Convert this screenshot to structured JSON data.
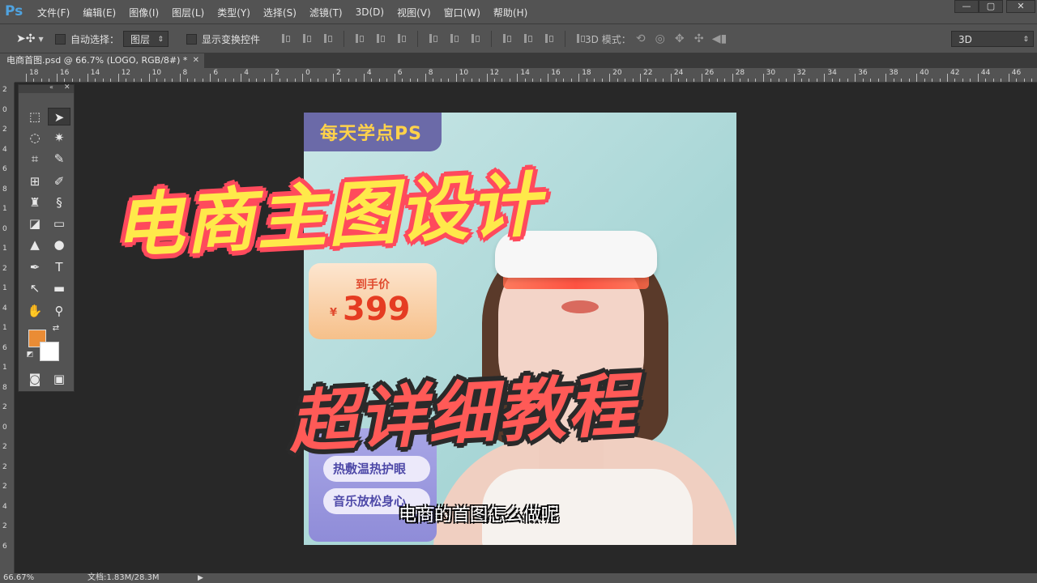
{
  "app": {
    "logo": "Ps"
  },
  "menu": [
    "文件(F)",
    "编辑(E)",
    "图像(I)",
    "图层(L)",
    "类型(Y)",
    "选择(S)",
    "滤镜(T)",
    "3D(D)",
    "视图(V)",
    "窗口(W)",
    "帮助(H)"
  ],
  "window_controls": {
    "minimize": "—",
    "restore": "▢",
    "close": "✕"
  },
  "options": {
    "auto_select_label": "自动选择：",
    "auto_select_target": "图层",
    "show_transform_label": "显示变换控件",
    "mode_3d_label": "3D 模式：",
    "workspace": "3D"
  },
  "document_tab": {
    "title": "电商首图.psd @ 66.7% (LOGO, RGB/8#) *",
    "close": "✕"
  },
  "ruler_top_labels": [
    "18",
    "16",
    "14",
    "12",
    "10",
    "8",
    "6",
    "4",
    "2",
    "0",
    "2",
    "4",
    "6",
    "8",
    "10",
    "12",
    "14",
    "16",
    "18",
    "20",
    "22",
    "24",
    "26",
    "28",
    "30",
    "32",
    "34",
    "36",
    "38",
    "40",
    "42",
    "44",
    "46"
  ],
  "ruler_left_labels": [
    "2",
    "0",
    "2",
    "4",
    "6",
    "8",
    "1",
    "0",
    "1",
    "2",
    "1",
    "4",
    "1",
    "6",
    "1",
    "8",
    "2",
    "0",
    "2",
    "2",
    "2",
    "4",
    "2",
    "6"
  ],
  "tools_panel": {
    "collapse": "«",
    "close": "✕"
  },
  "colors": {
    "foreground": "#ea8c35",
    "background": "#ffffff",
    "title_main": "#ffe94a",
    "title_main_stroke": "#ff4a5c",
    "title_sub": "#ff5a57"
  },
  "canvas": {
    "brand_tag": "每天学点PS",
    "price_label": "到手价",
    "price_currency": "¥",
    "price_value": "399",
    "features": [
      "热敷温热护眼",
      "音乐放松身心"
    ]
  },
  "overlay": {
    "title_main": "电商主图设计",
    "title_sub": "超详细教程",
    "subtitle": "电商的首图怎么做呢"
  },
  "status": {
    "zoom": "66.67%",
    "doc_info": "文档:1.83M/28.3M",
    "arrow": "▶"
  }
}
